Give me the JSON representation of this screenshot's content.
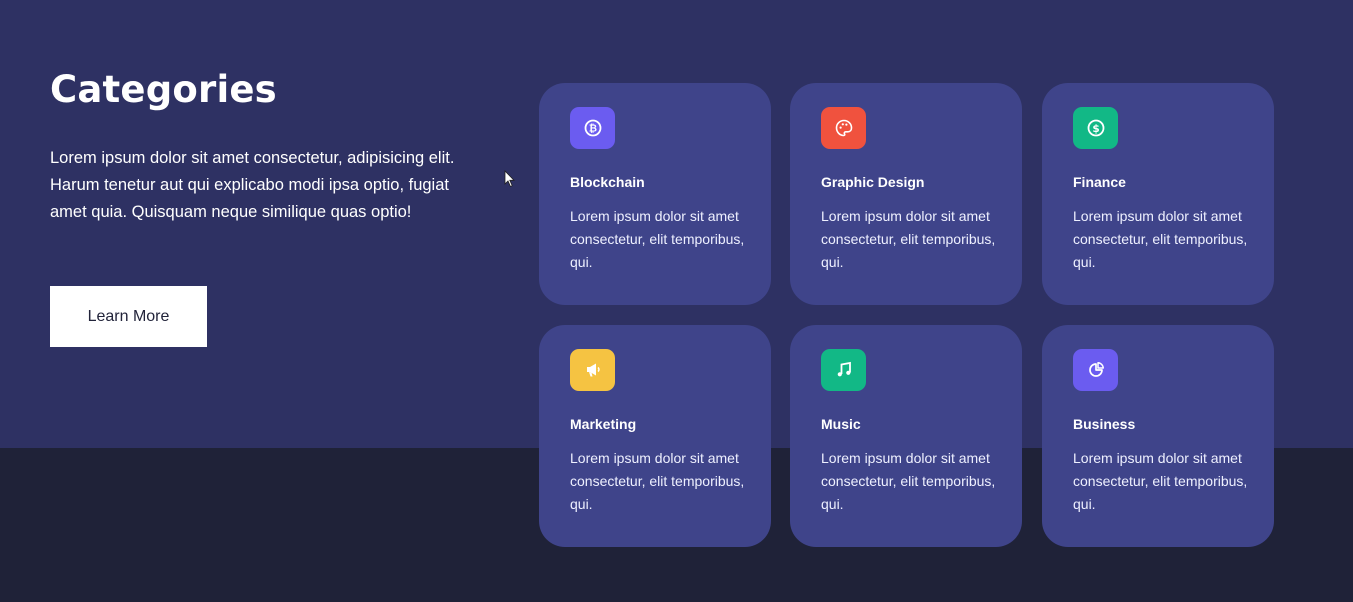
{
  "section": {
    "title": "Categories",
    "description": "Lorem ipsum dolor sit amet consectetur, adipisicing elit. Harum tenetur aut qui explicabo modi ipsa optio, fugiat amet quia. Quisquam neque similique quas optio!",
    "button_label": "Learn More"
  },
  "cards": [
    {
      "title": "Blockchain",
      "text": "Lorem ipsum dolor sit amet consectetur, elit temporibus, qui.",
      "icon": "bitcoin-icon",
      "color": "#6b5cf0"
    },
    {
      "title": "Graphic Design",
      "text": "Lorem ipsum dolor sit amet consectetur, elit temporibus, qui.",
      "icon": "palette-icon",
      "color": "#f0523e"
    },
    {
      "title": "Finance",
      "text": "Lorem ipsum dolor sit amet consectetur, elit temporibus, qui.",
      "icon": "dollar-icon",
      "color": "#12b886"
    },
    {
      "title": "Marketing",
      "text": "Lorem ipsum dolor sit amet consectetur, elit temporibus, qui.",
      "icon": "megaphone-icon",
      "color": "#f5c342"
    },
    {
      "title": "Music",
      "text": "Lorem ipsum dolor sit amet consectetur, elit temporibus, qui.",
      "icon": "music-note-icon",
      "color": "#12b886"
    },
    {
      "title": "Business",
      "text": "Lorem ipsum dolor sit amet consectetur, elit temporibus, qui.",
      "icon": "pie-chart-icon",
      "color": "#6b5cf0"
    }
  ]
}
